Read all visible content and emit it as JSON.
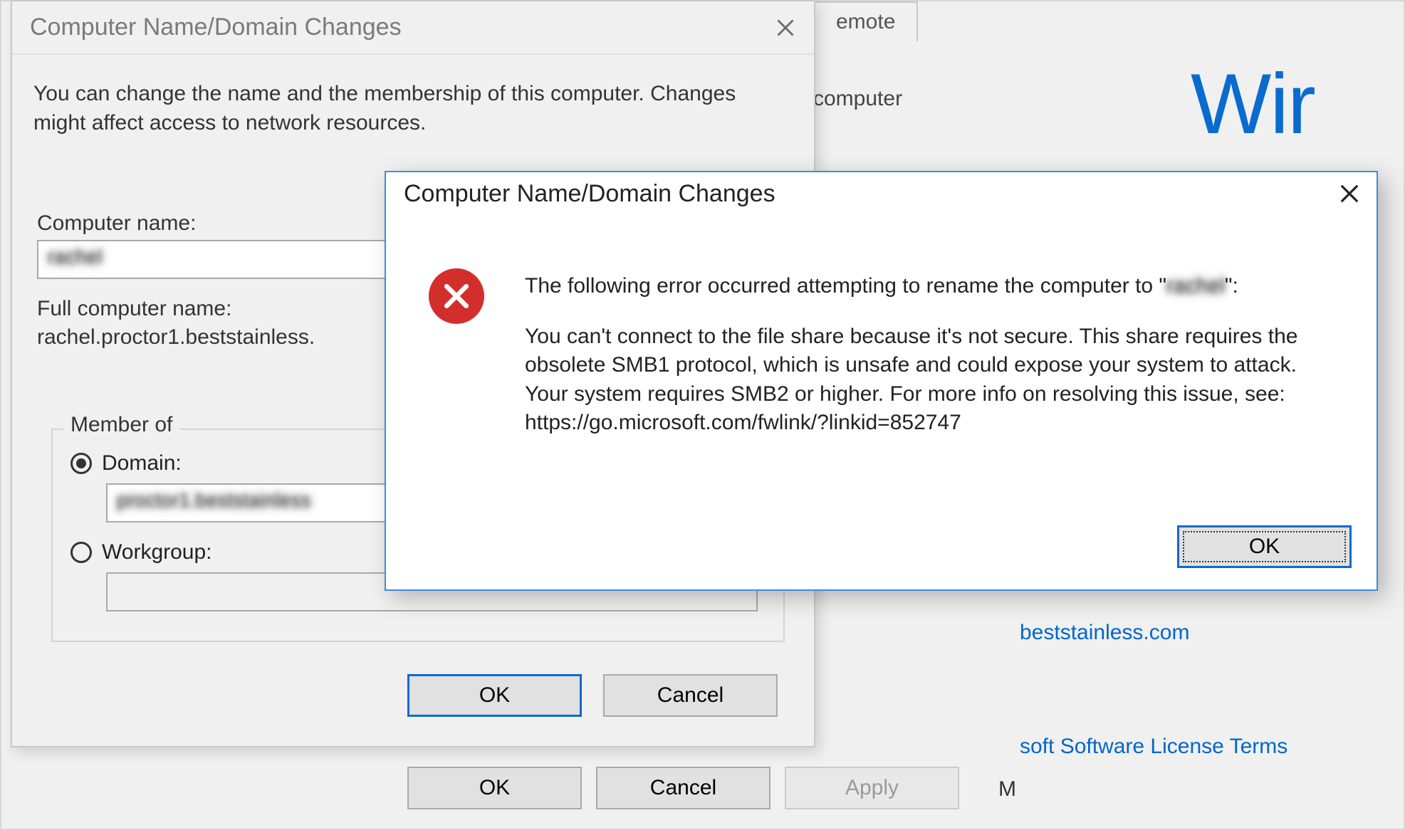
{
  "sysprops": {
    "tab_remote": "emote",
    "body_text": "computer",
    "btn_ok": "OK",
    "btn_cancel": "Cancel",
    "btn_apply": "Apply",
    "right_domain": "beststainless.com",
    "right_license": "soft Software License Terms",
    "right_letter": "M",
    "winlogo": "Wir"
  },
  "rename": {
    "title": "Computer Name/Domain Changes",
    "desc": "You can change the name and the membership of this computer. Changes might affect access to network resources.",
    "lbl_computer_name": "Computer name:",
    "val_computer_name": "rachel",
    "lbl_full_name": "Full computer name:",
    "val_full_name": "rachel.proctor1.beststainless.",
    "group_legend": "Member of",
    "radio_domain": "Domain:",
    "val_domain": "proctor1.beststainless",
    "radio_workgroup": "Workgroup:",
    "val_workgroup": "",
    "btn_ok": "OK",
    "btn_cancel": "Cancel"
  },
  "error": {
    "title": "Computer Name/Domain Changes",
    "msg_line1a": "The following error occurred attempting to rename the computer to \"",
    "msg_line1_redacted": "rachel",
    "msg_line1b": "\":",
    "msg_body": "You can't connect to the file share because it's not secure. This share requires the obsolete SMB1 protocol, which is unsafe and could expose your system to attack. Your system requires SMB2 or higher. For more info on resolving this issue, see: https://go.microsoft.com/fwlink/?linkid=852747",
    "btn_ok": "OK"
  }
}
